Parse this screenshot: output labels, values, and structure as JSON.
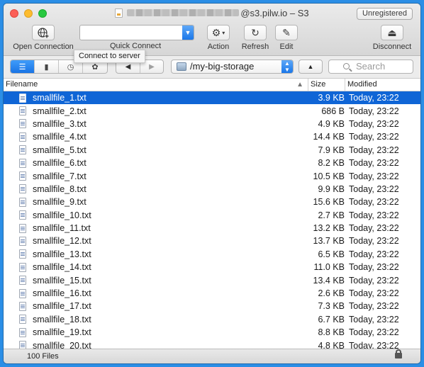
{
  "window": {
    "title_suffix": "@s3.pilw.io – S3",
    "badge": "Unregistered"
  },
  "toolbar": {
    "open_connection": "Open Connection",
    "quick_connect": "Quick Connect",
    "quick_connect_value": "",
    "action": "Action",
    "refresh": "Refresh",
    "edit": "Edit",
    "disconnect": "Disconnect",
    "tooltip": "Connect to server"
  },
  "navbar": {
    "path": "/my-big-storage",
    "search_placeholder": "Search"
  },
  "columns": {
    "filename": "Filename",
    "size": "Size",
    "modified": "Modified"
  },
  "files": [
    {
      "name": "smallfile_1.txt",
      "size": "3.9 KB",
      "modified": "Today, 23:22"
    },
    {
      "name": "smallfile_2.txt",
      "size": "686 B",
      "modified": "Today, 23:22"
    },
    {
      "name": "smallfile_3.txt",
      "size": "4.9 KB",
      "modified": "Today, 23:22"
    },
    {
      "name": "smallfile_4.txt",
      "size": "14.4 KB",
      "modified": "Today, 23:22"
    },
    {
      "name": "smallfile_5.txt",
      "size": "7.9 KB",
      "modified": "Today, 23:22"
    },
    {
      "name": "smallfile_6.txt",
      "size": "8.2 KB",
      "modified": "Today, 23:22"
    },
    {
      "name": "smallfile_7.txt",
      "size": "10.5 KB",
      "modified": "Today, 23:22"
    },
    {
      "name": "smallfile_8.txt",
      "size": "9.9 KB",
      "modified": "Today, 23:22"
    },
    {
      "name": "smallfile_9.txt",
      "size": "15.6 KB",
      "modified": "Today, 23:22"
    },
    {
      "name": "smallfile_10.txt",
      "size": "2.7 KB",
      "modified": "Today, 23:22"
    },
    {
      "name": "smallfile_11.txt",
      "size": "13.2 KB",
      "modified": "Today, 23:22"
    },
    {
      "name": "smallfile_12.txt",
      "size": "13.7 KB",
      "modified": "Today, 23:22"
    },
    {
      "name": "smallfile_13.txt",
      "size": "6.5 KB",
      "modified": "Today, 23:22"
    },
    {
      "name": "smallfile_14.txt",
      "size": "11.0 KB",
      "modified": "Today, 23:22"
    },
    {
      "name": "smallfile_15.txt",
      "size": "13.4 KB",
      "modified": "Today, 23:22"
    },
    {
      "name": "smallfile_16.txt",
      "size": "2.6 KB",
      "modified": "Today, 23:22"
    },
    {
      "name": "smallfile_17.txt",
      "size": "7.3 KB",
      "modified": "Today, 23:22"
    },
    {
      "name": "smallfile_18.txt",
      "size": "6.7 KB",
      "modified": "Today, 23:22"
    },
    {
      "name": "smallfile_19.txt",
      "size": "8.8 KB",
      "modified": "Today, 23:22"
    },
    {
      "name": "smallfile_20.txt",
      "size": "4.8 KB",
      "modified": "Today, 23:22"
    }
  ],
  "selected_index": 0,
  "status": {
    "file_count": "100 Files"
  },
  "colors": {
    "selection": "#0f65d6",
    "accent": "#1a77e9"
  }
}
